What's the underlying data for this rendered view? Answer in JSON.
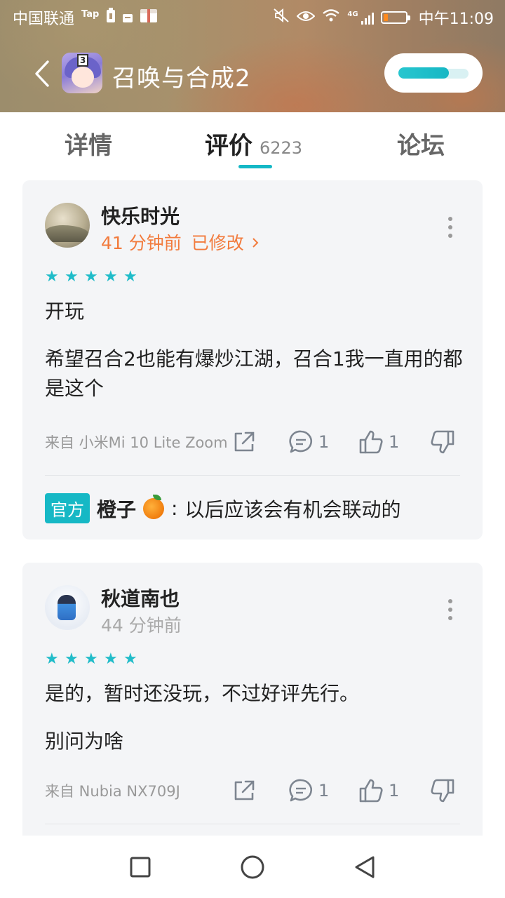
{
  "status_bar": {
    "carrier": "中国联通",
    "carrier_badge": "Tap",
    "network": "4G",
    "time": "中午11:09",
    "battery_color": "#ff8a1e"
  },
  "header": {
    "app_name": "召唤与合成2",
    "app_icon": "anime-girl-app-icon",
    "back_icon": "chevron-left-icon",
    "progress_fraction": 0.72,
    "accent": "#15b8c6"
  },
  "tabs": {
    "detail": "详情",
    "review": "评价",
    "review_count": "6223",
    "forum": "论坛",
    "active": "review"
  },
  "reviews": [
    {
      "username": "快乐时光",
      "time": "41 分钟前",
      "edited_label": "已修改",
      "stars": 5,
      "lines": [
        "开玩",
        "希望召合2也能有爆炒江湖，召合1我一直用的都是这个"
      ],
      "device": "来自 小米Mi 10 Lite Zoom",
      "reply_count": "1",
      "like_count": "1",
      "official_reply": {
        "badge": "官方",
        "author": "橙子",
        "text": "以后应该会有机会联动的"
      }
    },
    {
      "username": "秋道南也",
      "time": "44 分钟前",
      "stars": 5,
      "lines": [
        "是的，暂时还没玩，不过好评先行。",
        "别问为啥"
      ],
      "device": "来自 Nubia NX709J",
      "reply_count": "1",
      "like_count": "1"
    }
  ],
  "icons": {
    "share": "share-icon",
    "comment": "comment-icon",
    "like": "thumbs-up-icon",
    "dislike": "thumbs-down-icon",
    "more": "more-vertical-icon",
    "star": "star-icon"
  },
  "navbar": {
    "recent": "square-icon",
    "home": "circle-icon",
    "back": "triangle-back-icon"
  }
}
